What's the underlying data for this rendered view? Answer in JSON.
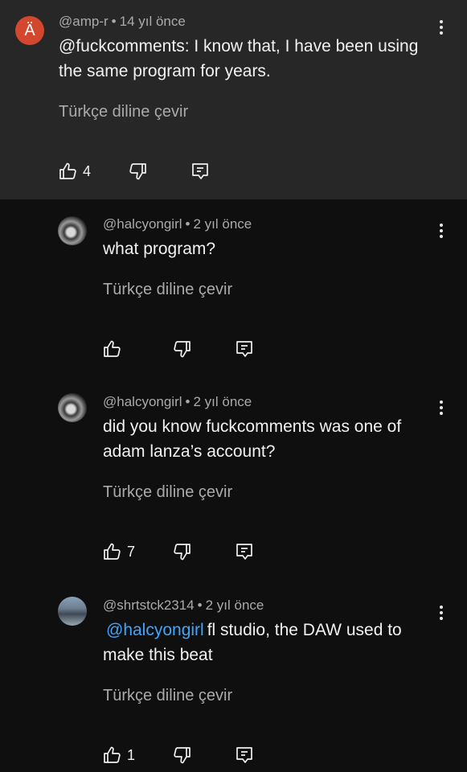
{
  "translate_label": "Türkçe diline çevir",
  "comments": [
    {
      "avatar_letter": "Ä",
      "author": "@amp-r",
      "separator": "•",
      "time": "14 yıl önce",
      "text_line1": "@fuckcomments: I know that, I have been using",
      "text_line2": "the same program for years.",
      "likes": "4"
    },
    {
      "author": "@halcyongirl",
      "separator": "•",
      "time": "2 yıl önce",
      "text_line1": "what program?",
      "likes": ""
    },
    {
      "author": "@halcyongirl",
      "separator": "•",
      "time": "2 yıl önce",
      "text_line1": "did you know fuckcomments was one of",
      "text_line2": "adam lanza’s account?",
      "likes": "7"
    },
    {
      "author": "@shrtstck2314",
      "separator": "•",
      "time": "2 yıl önce",
      "mention": "@halcyongirl",
      "text_line1": "fl studio, the DAW used to",
      "text_line2": "make this beat",
      "likes": "1"
    }
  ],
  "icons": {
    "like": "thumbs-up-icon",
    "dislike": "thumbs-down-icon",
    "reply": "reply-icon",
    "more": "more-vertical-icon"
  },
  "colors": {
    "background": "#0f0f0f",
    "highlight_background": "#272727",
    "avatar_accent": "#d2472e",
    "mention": "#3ea6ff",
    "secondary_text": "#aaaaaa"
  }
}
